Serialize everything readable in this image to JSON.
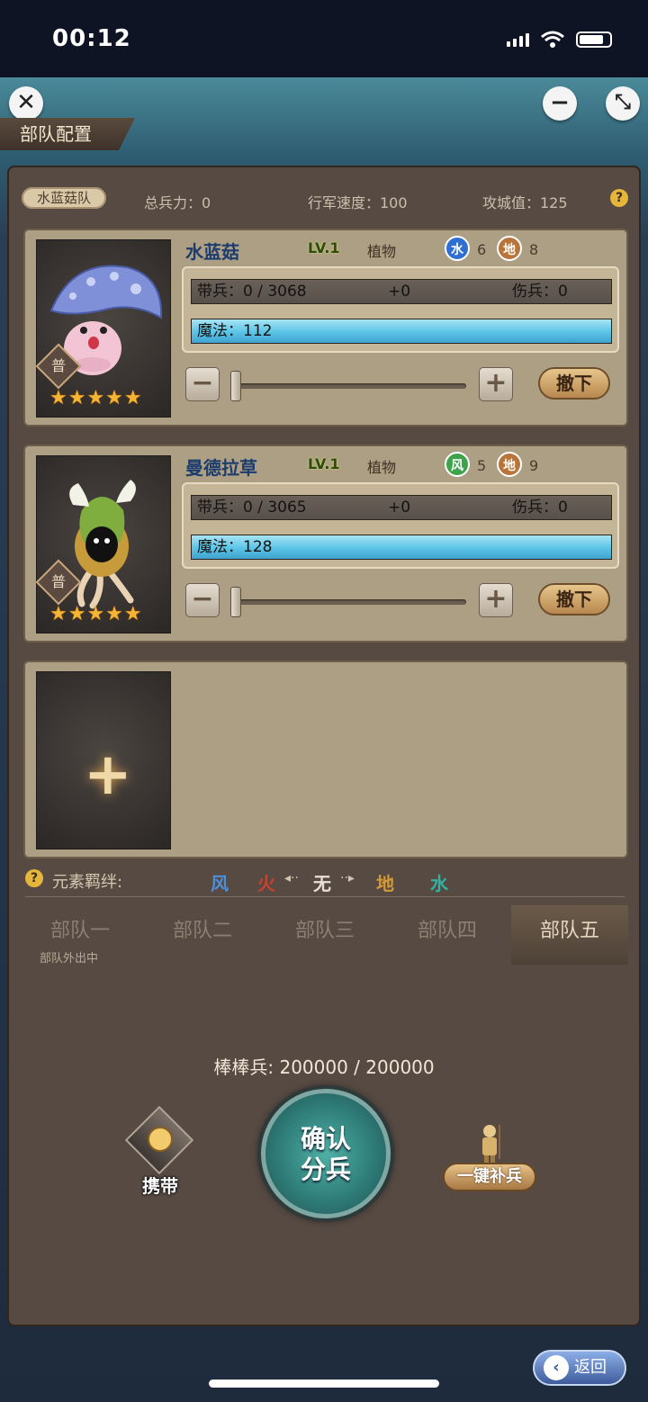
{
  "status": {
    "time": "00:12"
  },
  "header": {
    "title": "部队配置",
    "close_icon": "close-icon",
    "minimize_icon": "minimize-icon",
    "collapse_icon": "collapse-icon"
  },
  "summary": {
    "team_name": "水蓝菇队",
    "total_troops": "总兵力：0",
    "march_speed": "行军速度：100",
    "siege_value": "攻城值：125",
    "help": "?"
  },
  "units": [
    {
      "name": "水蓝菇",
      "level": "LV.1",
      "kind": "植物",
      "elem1": {
        "label": "水",
        "value": "6",
        "color": "#2f6fd2"
      },
      "elem2": {
        "label": "地",
        "value": "8",
        "color": "#b8743a"
      },
      "rarity": "普",
      "stars": "★★★★★",
      "troops": "带兵：0 / 3068",
      "bonus": "+0",
      "wounded": "伤兵：0",
      "magic": "魔法：112",
      "slider_fraction": 0,
      "minus": "−",
      "plus": "+",
      "withdraw": "撤下"
    },
    {
      "name": "曼德拉草",
      "level": "LV.1",
      "kind": "植物",
      "elem1": {
        "label": "风",
        "value": "5",
        "color": "#3ea34a"
      },
      "elem2": {
        "label": "地",
        "value": "9",
        "color": "#b8743a"
      },
      "rarity": "普",
      "stars": "★★★★★",
      "troops": "带兵：0 / 3065",
      "bonus": "+0",
      "wounded": "伤兵：0",
      "magic": "魔法：128",
      "slider_fraction": 0,
      "minus": "−",
      "plus": "+",
      "withdraw": "撤下"
    }
  ],
  "empty_slot": {
    "plus": "+"
  },
  "bond": {
    "help": "?",
    "label": "元素羁绊:",
    "elements": [
      {
        "label": "风",
        "color": "#4f8fd9"
      },
      {
        "label": "火",
        "color": "#c9412f"
      },
      {
        "label": "无",
        "color": "#e7e0d4"
      },
      {
        "label": "地",
        "color": "#d39a3a"
      },
      {
        "label": "水",
        "color": "#2fb3a3"
      }
    ],
    "arrow_left": "◂··",
    "arrow_right": "··▸"
  },
  "tabs": [
    {
      "label": "部队一",
      "sub": "部队外出中"
    },
    {
      "label": "部队二",
      "sub": ""
    },
    {
      "label": "部队三",
      "sub": ""
    },
    {
      "label": "部队四",
      "sub": ""
    },
    {
      "label": "部队五",
      "sub": "",
      "active": true
    }
  ],
  "reserve": "棒棒兵:  200000 / 200000",
  "actions": {
    "carry": "携带",
    "confirm_line1": "确认",
    "confirm_line2": "分兵",
    "supply": "一键补兵"
  },
  "footer": {
    "back": "返回"
  }
}
